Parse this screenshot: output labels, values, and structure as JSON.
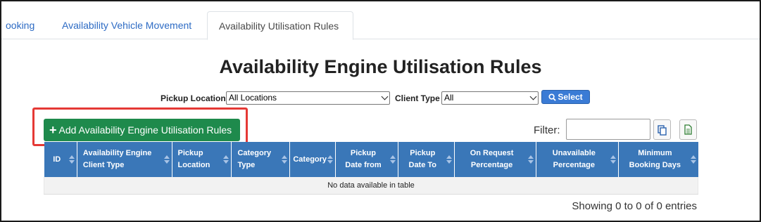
{
  "tabs": [
    {
      "label": "ooking"
    },
    {
      "label": "Availability Vehicle Movement"
    },
    {
      "label": "Availability Utilisation Rules"
    }
  ],
  "page": {
    "title": "Availability Engine Utilisation Rules"
  },
  "filters": {
    "pickup_location_label": "Pickup Location",
    "pickup_location_value": "All Locations",
    "client_type_label": "Client Type",
    "client_type_value": "All",
    "select_button_label": "Select"
  },
  "add_button_label": "Add Availability Engine Utilisation Rules",
  "table_filter_label": "Filter:",
  "table": {
    "columns": [
      "ID",
      "Availability Engine Client Type",
      "Pickup Location",
      "Category Type",
      "Category",
      "Pickup Date from",
      "Pickup Date To",
      "On Request Percentage",
      "Unavailable Percentage",
      "Minimum Booking Days"
    ],
    "empty_message": "No data available in table"
  },
  "info_text": "Showing 0 to 0 of 0 entries",
  "colors": {
    "header_blue": "#3a77b8",
    "add_green": "#1e8a4c",
    "highlight_red": "#e53935",
    "tab_link": "#2d6bc4"
  }
}
